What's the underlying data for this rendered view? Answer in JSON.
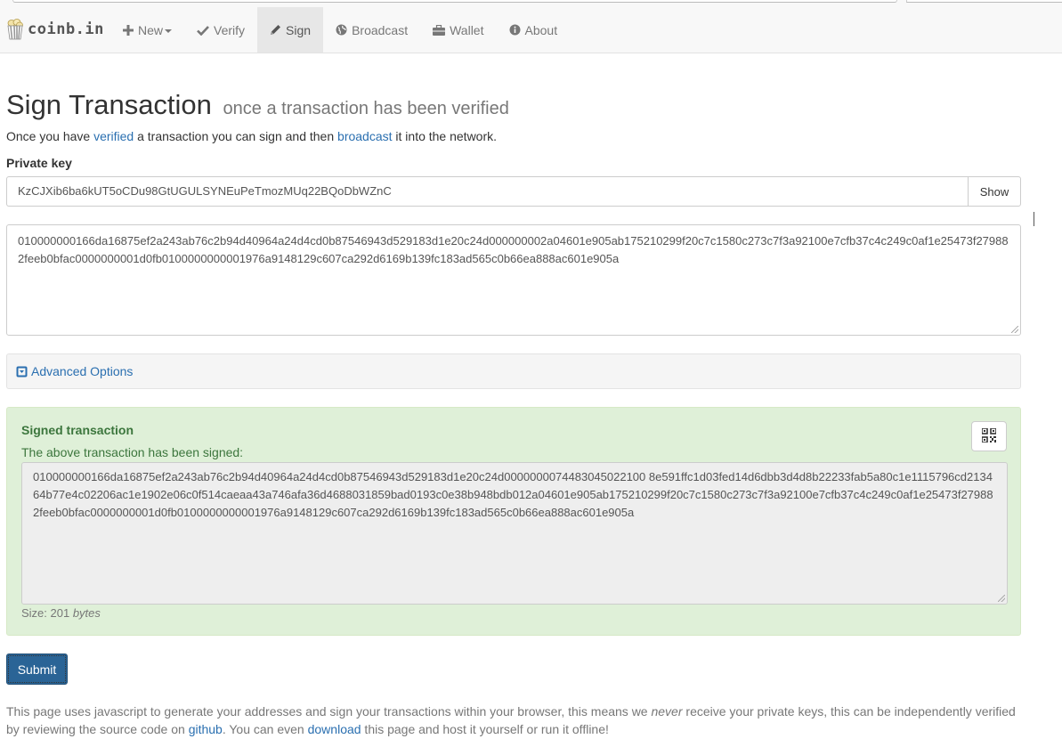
{
  "brand": {
    "name": "coinb.in"
  },
  "nav": {
    "new": "New",
    "verify": "Verify",
    "sign": "Sign",
    "broadcast": "Broadcast",
    "wallet": "Wallet",
    "about": "About"
  },
  "page": {
    "title": "Sign Transaction",
    "subtitle": "once a transaction has been verified",
    "intro_pre": "Once you have ",
    "intro_link1": "verified",
    "intro_mid": " a transaction you can sign and then ",
    "intro_link2": "broadcast",
    "intro_post": " it into the network."
  },
  "private_key": {
    "label": "Private key",
    "value": "KzCJXib6ba6kUT5oCDu98GtUGULSYNEuPeTmozMUq22BQoDbWZnC",
    "show_label": "Show"
  },
  "transaction": {
    "value": "010000000166da16875ef2a243ab76c2b94d40964a24d4cd0b87546943d529183d1e20c24d000000002a04601e905ab175210299f20c7c1580c273c7f3a92100e7cfb37c4c249c0af1e25473f279882feeb0bfac0000000001d0fb0100000000001976a9148129c607ca292d6169b139fc183ad565c0b66ea888ac601e905a"
  },
  "advanced": {
    "label": "Advanced Options"
  },
  "signed": {
    "title": "Signed transaction",
    "subtitle": "The above transaction has been signed:",
    "value": "010000000166da16875ef2a243ab76c2b94d40964a24d4cd0b87546943d529183d1e20c24d0000000074483045022100 8e591ffc1d03fed14d6dbb3d4d8b22233fab5a80c1e1115796cd213464b77e4c02206ac1e1902e06c0f514caeaa43a746afa36d4688031859bad0193c0e38b948bdb012a04601e905ab175210299f20c7c1580c273c7f3a92100e7cfb37c4c249c0af1e25473f279882feeb0bfac0000000001d0fb0100000000001976a9148129c607ca292d6169b139fc183ad565c0b66ea888ac601e905a",
    "size_prefix": "Size: 201 ",
    "size_unit": "bytes"
  },
  "submit": {
    "label": "Submit"
  },
  "footer": {
    "text1": "This page uses javascript to generate your addresses and sign your transactions within your browser, this means we ",
    "never": "never",
    "text2": " receive your private keys, this can be independently verified by reviewing the source code on ",
    "github": "github",
    "text3": ". You can even ",
    "download": "download",
    "text4": " this page and host it yourself or run it offline!"
  }
}
